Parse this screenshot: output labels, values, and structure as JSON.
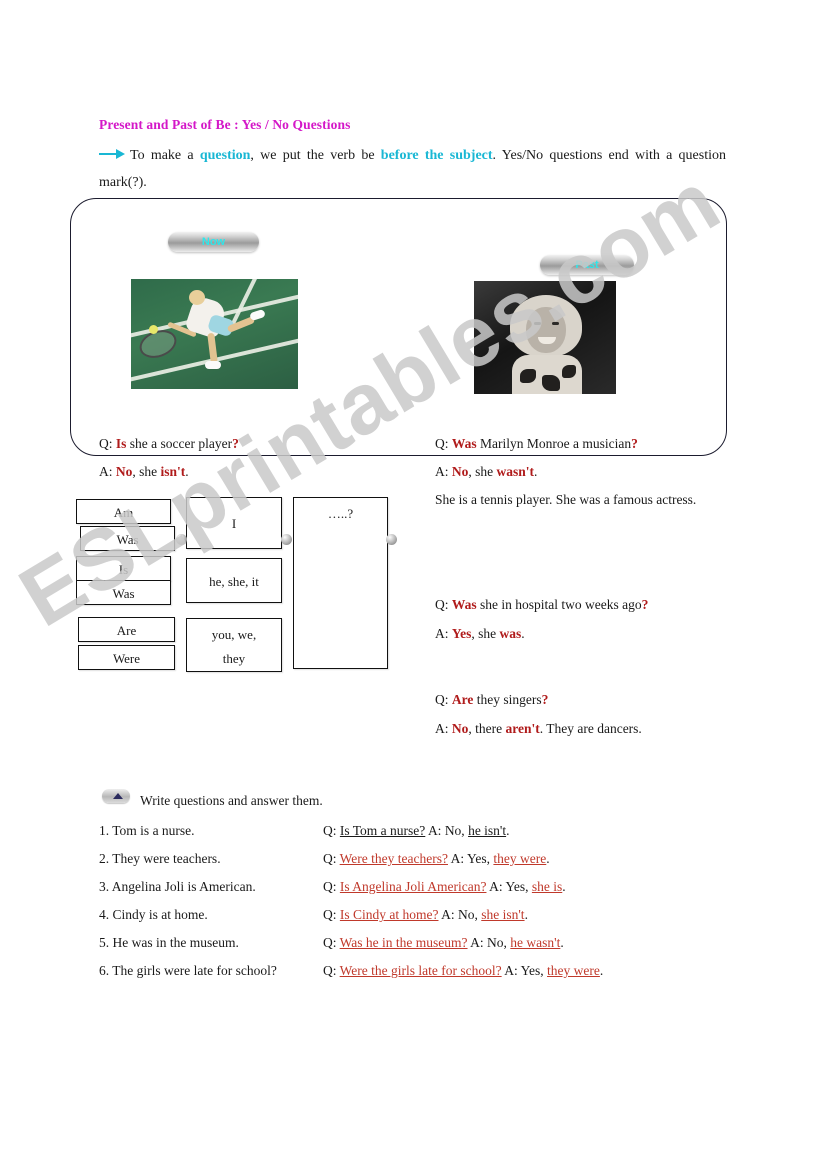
{
  "title": "Present and Past of Be : Yes / No Questions",
  "intro": {
    "part1": "To make a ",
    "kw1": "question",
    "part2": ", we put the verb be ",
    "kw2": "before the subject",
    "part3": ". Yes/No questions end with a question mark(?)."
  },
  "panel": {
    "pill_now": "Now",
    "pill_past": "Past",
    "left": {
      "q_label": "Q:",
      "q_key": "Is",
      "q_text": "she a soccer player",
      "q_mark": "?",
      "a_label": "A:",
      "a_key1": "No",
      "a_mid": ", she ",
      "a_key2": "isn't",
      "a_end": "."
    },
    "right": {
      "q_label": "Q:",
      "q_key": "Was",
      "q_text": "Marilyn Monroe a musician",
      "q_mark": "?",
      "a_label": "A:",
      "a_key1": "No",
      "a_mid": ", she ",
      "a_key2": "wasn't",
      "a_end": "."
    }
  },
  "note": "She is a tennis player. She was a famous actress.",
  "grammar_boxes": {
    "col1": [
      "Am",
      "Was",
      "Is",
      "Was",
      "Are",
      "Were"
    ],
    "col2": [
      "I",
      "he, she, it",
      "you, we, they"
    ],
    "col3": "…..?"
  },
  "extra_qa": [
    {
      "q_label": "Q:",
      "q_key": "Was",
      "q_text": "she in hospital two weeks ago",
      "q_mark": "?",
      "a_label": "A:",
      "a_key1": "Yes",
      "a_mid": ", she ",
      "a_key2": "was",
      "a_end": "."
    },
    {
      "q_label": "Q:",
      "q_key": "Are",
      "q_text": "they singers",
      "q_mark": "?",
      "a_label": "A:",
      "a_key1": "No",
      "a_mid": ", there ",
      "a_key2": "aren't",
      "a_end": ". They are dancers."
    }
  ],
  "exercise": {
    "heading": "Write questions and answer them.",
    "rows": [
      {
        "prompt": "1. Tom is a nurse.",
        "q_label": "Q:",
        "question": "Is Tom a nurse?",
        "a_label": "A:",
        "a_yesno": "No,",
        "answer": "he isn't",
        "a_end": ".",
        "style": "black"
      },
      {
        "prompt": "2. They were teachers.",
        "q_label": "Q:",
        "question": "Were they teachers?",
        "a_label": "A:",
        "a_yesno": "Yes,",
        "answer": "they were",
        "a_end": ".",
        "style": "red"
      },
      {
        "prompt": "3. Angelina Joli is American.",
        "q_label": "Q:",
        "question": "Is Angelina Joli American?",
        "a_label": "A:",
        "a_yesno": "Yes,",
        "answer": "she is",
        "a_end": ".",
        "style": "red"
      },
      {
        "prompt": "4. Cindy is at home.",
        "q_label": "Q:",
        "question": "Is Cindy at home?",
        "a_label": "A:",
        "a_yesno": "No,",
        "answer": "she isn't",
        "a_end": ".",
        "style": "red"
      },
      {
        "prompt": "5. He was in the museum.",
        "q_label": "Q:",
        "question": "Was he in the museum?",
        "a_label": "A:",
        "a_yesno": "No,",
        "answer": "he wasn't",
        "a_end": ".",
        "style": "red"
      },
      {
        "prompt": "6. The girls were late for school?",
        "q_label": "Q:",
        "question": "Were the girls late for school?",
        "a_label": "A:",
        "a_yesno": "Yes,",
        "answer": "they were",
        "a_end": ".",
        "style": "red"
      }
    ]
  },
  "watermark": "ESLprintables.com",
  "colors": {
    "title": "#d417c8",
    "accent_cyan": "#19b7d4",
    "keyword_red": "#b01b1b",
    "answer_red": "#c0392b",
    "pill_text": "#2ee6ea"
  }
}
